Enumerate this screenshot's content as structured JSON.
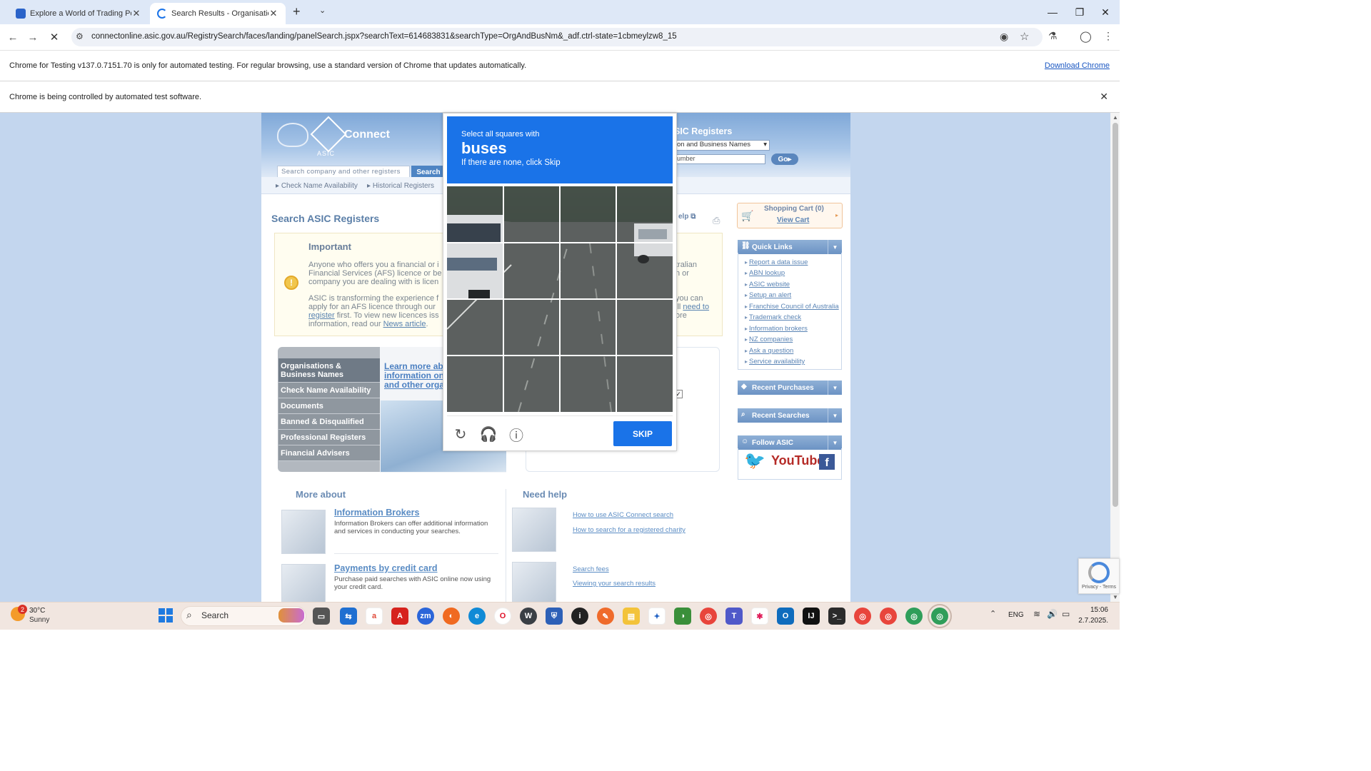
{
  "browser": {
    "tabs": [
      {
        "title": "Explore a World of Trading Pos"
      },
      {
        "title": "Search Results - Organisations"
      }
    ],
    "url": "connectonline.asic.gov.au/RegistrySearch/faces/landing/panelSearch.jspx?searchText=614683831&searchType=OrgAndBusNm&_adf.ctrl-state=1cbmeylzw8_15",
    "infobar_testing": "Chrome for Testing v137.0.7151.70 is only for automated testing. For regular browsing, use a standard version of Chrome that updates automatically.",
    "download_link": "Download Chrome",
    "infobar_automation": "Chrome is being controlled by automated test software."
  },
  "asic": {
    "connect_label": "Connect",
    "asic_label": "ASIC",
    "search_placeholder": "Search company and other registers",
    "search_button": "Search",
    "crumbs": [
      "Check Name Availability",
      "Historical Registers"
    ],
    "registers_title": "SIC Registers",
    "registers_select": "on and Business Names",
    "registers_number": "umber",
    "go_button": "Go",
    "page_title": "Search ASIC Registers",
    "help_label": "elp",
    "important": {
      "heading": "Important",
      "lines_left": [
        "Anyone who offers you a financial or i",
        "Financial Services (AFS) licence or be",
        "company you are dealing with is licen"
      ],
      "lines_left2": [
        "ASIC is transforming the experience f",
        "apply for an AFS licence through our",
        "register first. To view new licences iss",
        "information, read our News article."
      ],
      "register_link": "register",
      "news_link": "News article",
      "right_fragments": [
        "tralian",
        "n or",
        "you can",
        "ill need to",
        "ore"
      ]
    },
    "menu": [
      "Organisations & Business Names",
      "Check Name Availability",
      "Documents",
      "Banned & Disqualified",
      "Professional Registers",
      "Financial Advisers"
    ],
    "learn_more": [
      "Learn more abo",
      "information on",
      "and other orga"
    ],
    "more_about": "More about",
    "need_help": "Need help",
    "info_brokers": {
      "title": "Information Brokers",
      "desc": "Information Brokers can offer additional information and services in conducting your searches."
    },
    "payments": {
      "title": "Payments by credit card",
      "desc": "Purchase paid searches with ASIC online now using your credit card."
    },
    "help_links": [
      "How to use ASIC Connect search",
      "How to search for a registered charity",
      "Search fees",
      "Viewing your search results"
    ],
    "sidebar": {
      "cart_title": "Shopping Cart (0)",
      "view_cart": "View Cart",
      "quick_links_title": "Quick Links",
      "quick_links": [
        "Report a data issue",
        "ABN lookup",
        "ASIC website",
        "Setup an alert",
        "Franchise Council of Australia",
        "Trademark check",
        "Information brokers",
        "NZ companies",
        "Ask a question",
        "Service availability"
      ],
      "recent_purchases": "Recent Purchases",
      "recent_searches": "Recent Searches",
      "follow": "Follow ASIC",
      "youtube": "YouTube"
    }
  },
  "captcha": {
    "instruction": "Select all squares with",
    "target": "buses",
    "fallback": "If there are none, click Skip",
    "skip_button": "SKIP",
    "grid_selected": [],
    "icons": [
      "reload-icon",
      "audio-icon",
      "info-icon"
    ]
  },
  "recaptcha_badge": "Privacy - Terms",
  "taskbar": {
    "weather_temp": "30°C",
    "weather_desc": "Sunny",
    "weather_badge": "2",
    "search_label": "Search",
    "lang": "ENG",
    "time": "15:06",
    "date": "2.7.2025."
  }
}
